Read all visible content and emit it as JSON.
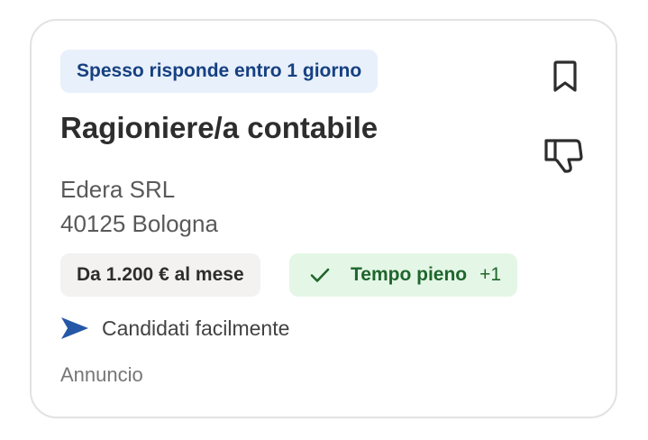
{
  "card": {
    "response_badge": "Spesso risponde entro 1 giorno",
    "title": "Ragioniere/a contabile",
    "company": "Edera SRL",
    "location": "40125 Bologna",
    "salary": "Da 1.200 € al mese",
    "job_type": "Tempo pieno",
    "job_type_more": "+1",
    "easy_apply": "Candidati facilmente",
    "sponsored": "Annuncio"
  },
  "icons": {
    "bookmark": "bookmark-icon",
    "dislike": "thumbs-down-icon",
    "check": "check-icon",
    "easy_apply": "send-arrow-icon"
  },
  "colors": {
    "badge_bg": "#e8f0fb",
    "badge_text": "#164081",
    "chip_green_bg": "#e4f7e6",
    "chip_green_text": "#1f662c",
    "chip_gray_bg": "#f3f2f1",
    "accent_blue": "#2557a7"
  }
}
